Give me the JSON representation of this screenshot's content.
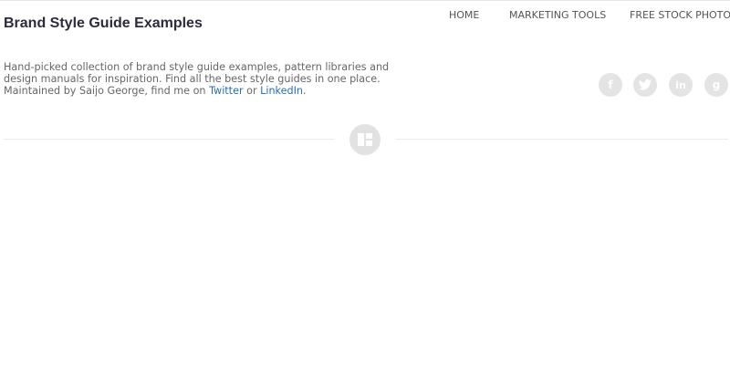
{
  "site": {
    "title": "Brand Style Guide Examples"
  },
  "nav": {
    "items": [
      {
        "label": "HOME"
      },
      {
        "label": "MARKETING TOOLS"
      },
      {
        "label": "FREE STOCK PHOTOS"
      }
    ]
  },
  "intro": {
    "text_part1": "Hand-picked collection of brand style guide examples, pattern libraries and design manuals for inspiration. Find all the best style guides in one place. Maintained by Saijo George, find me on ",
    "twitter_link": "Twitter",
    "text_part2": " or ",
    "linkedin_link": "LinkedIn",
    "text_part3": "."
  },
  "social": [
    {
      "icon": "facebook-icon",
      "glyph": "f"
    },
    {
      "icon": "twitter-icon",
      "glyph": "t"
    },
    {
      "icon": "linkedin-icon",
      "glyph": "in"
    },
    {
      "icon": "google-plus-icon",
      "glyph": "g"
    }
  ],
  "layout_toggle": {
    "icon": "grid-view-icon"
  },
  "colors": {
    "link": "#2a6fb0",
    "title": "#2b2b3a",
    "icon_circle": "#e4e4e4"
  }
}
